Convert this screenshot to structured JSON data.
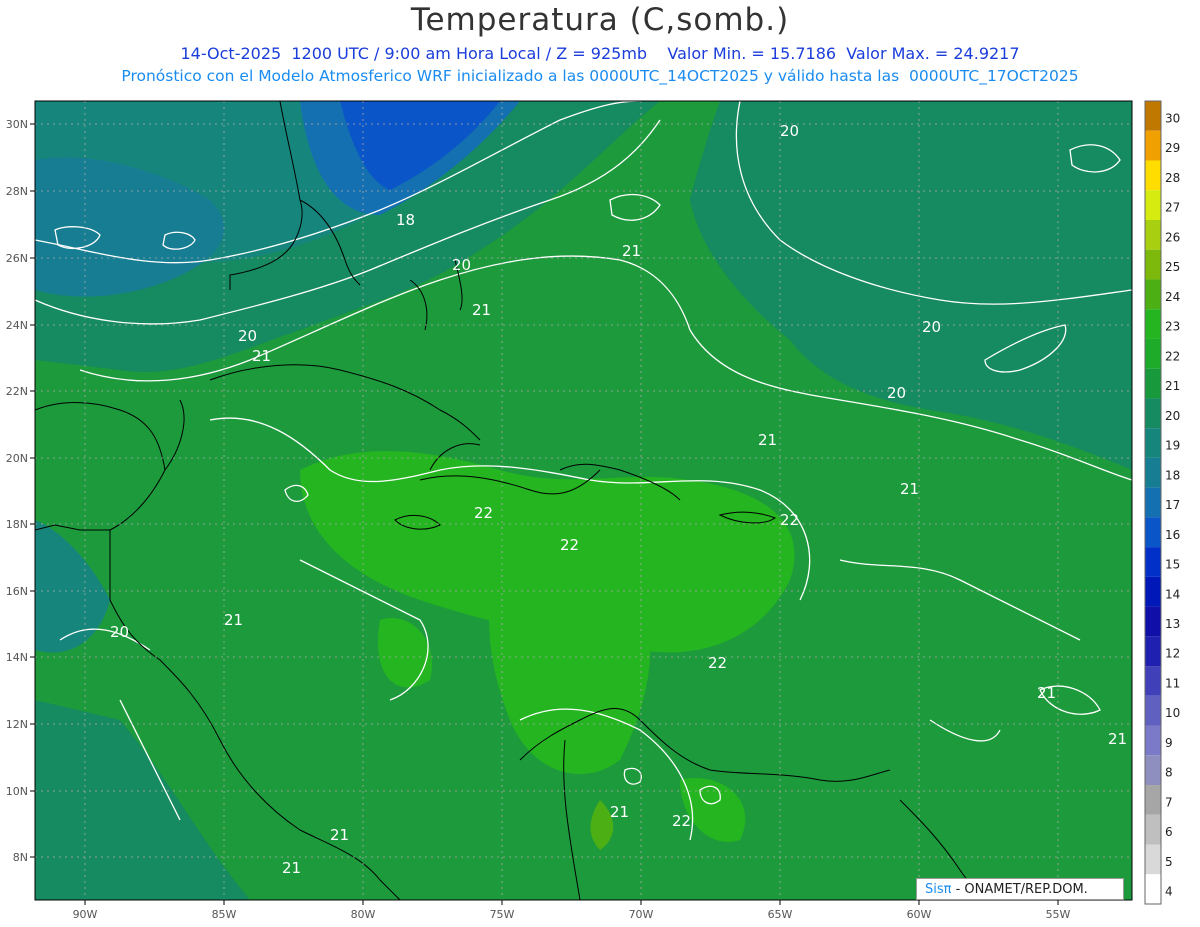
{
  "header": {
    "title": "Temperatura (C,somb.)",
    "line1": "14-Oct-2025  1200 UTC / 9:00 am Hora Local / Z = 925mb    Valor Min. = 15.7186  Valor Max. = 24.9217",
    "line2": "Pronóstico con el Modelo Atmosferico WRF inicializado a las 0000UTC_14OCT2025 y válido hasta las  0000UTC_17OCT2025"
  },
  "axes": {
    "lon_labels": [
      "90W",
      "85W",
      "80W",
      "75W",
      "70W",
      "65W",
      "60W",
      "55W"
    ],
    "lat_labels": [
      "30N",
      "28N",
      "26N",
      "24N",
      "22N",
      "20N",
      "18N",
      "16N",
      "14N",
      "12N",
      "10N",
      "8N"
    ]
  },
  "contour_labels": [
    "20",
    "18",
    "20",
    "21",
    "21",
    "20",
    "21",
    "20",
    "20",
    "21",
    "21",
    "22",
    "22",
    "22",
    "21",
    "20",
    "21",
    "22",
    "21",
    "21",
    "21",
    "22",
    "21",
    "21"
  ],
  "colorbar": {
    "levels": [
      "4",
      "5",
      "6",
      "7",
      "8",
      "9",
      "10",
      "11",
      "12",
      "13",
      "14",
      "15",
      "16",
      "17",
      "18",
      "19",
      "20",
      "21",
      "22",
      "23",
      "24",
      "25",
      "26",
      "27",
      "28",
      "29",
      "30"
    ],
    "colors": [
      "#ffffff",
      "#d9d9d9",
      "#bfbfbf",
      "#a6a6a6",
      "#8f8fbf",
      "#7a7ac8",
      "#6060c0",
      "#4040b8",
      "#2020b0",
      "#1010a8",
      "#0018b8",
      "#0030c8",
      "#0a55c8",
      "#1470b0",
      "#167d93",
      "#16867d",
      "#168a60",
      "#189a3c",
      "#1eab2a",
      "#24b520",
      "#4caf14",
      "#7db80c",
      "#a8d010",
      "#d6ec10",
      "#ffdd00",
      "#f0a000",
      "#c07800"
    ]
  },
  "footer": {
    "brand": "Sisπ",
    "org": " - ONAMET/REP.DOM."
  }
}
